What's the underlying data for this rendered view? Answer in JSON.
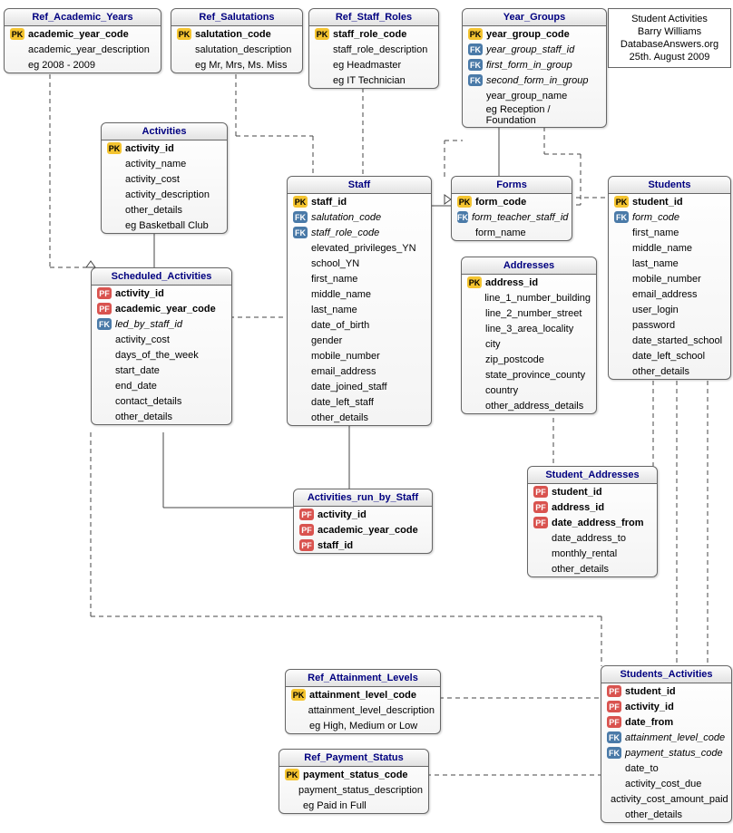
{
  "info_box": {
    "l1": "Student Activities",
    "l2": "Barry Williams",
    "l3": "DatabaseAnswers.org",
    "l4": "25th. August 2009"
  },
  "key_labels": {
    "pk": "PK",
    "fk": "FK",
    "pf": "PF"
  },
  "entities": {
    "ref_academic_years": {
      "title": "Ref_Academic_Years",
      "attrs": [
        {
          "k": "pk",
          "t": "academic_year_code",
          "b": true
        },
        {
          "t": "academic_year_description"
        },
        {
          "t": "eg 2008 - 2009"
        }
      ]
    },
    "ref_salutations": {
      "title": "Ref_Salutations",
      "attrs": [
        {
          "k": "pk",
          "t": "salutation_code",
          "b": true
        },
        {
          "t": "salutation_description"
        },
        {
          "t": "eg Mr, Mrs, Ms. Miss"
        }
      ]
    },
    "ref_staff_roles": {
      "title": "Ref_Staff_Roles",
      "attrs": [
        {
          "k": "pk",
          "t": "staff_role_code",
          "b": true
        },
        {
          "t": "staff_role_description"
        },
        {
          "t": "eg Headmaster"
        },
        {
          "t": "eg IT Technician"
        }
      ]
    },
    "year_groups": {
      "title": "Year_Groups",
      "attrs": [
        {
          "k": "pk",
          "t": "year_group_code",
          "b": true
        },
        {
          "k": "fk",
          "t": "year_group_staff_id",
          "i": true
        },
        {
          "k": "fk",
          "t": "first_form_in_group",
          "i": true
        },
        {
          "k": "fk",
          "t": "second_form_in_group",
          "i": true
        },
        {
          "t": "year_group_name"
        },
        {
          "t": "eg Reception / Foundation"
        }
      ]
    },
    "activities": {
      "title": "Activities",
      "attrs": [
        {
          "k": "pk",
          "t": "activity_id",
          "b": true
        },
        {
          "t": "activity_name"
        },
        {
          "t": "activity_cost"
        },
        {
          "t": "activity_description"
        },
        {
          "t": "other_details"
        },
        {
          "t": "eg Basketball Club"
        }
      ]
    },
    "staff": {
      "title": "Staff",
      "attrs": [
        {
          "k": "pk",
          "t": "staff_id",
          "b": true
        },
        {
          "k": "fk",
          "t": "salutation_code",
          "i": true
        },
        {
          "k": "fk",
          "t": "staff_role_code",
          "i": true
        },
        {
          "t": "elevated_privileges_YN"
        },
        {
          "t": "school_YN"
        },
        {
          "t": "first_name"
        },
        {
          "t": "middle_name"
        },
        {
          "t": "last_name"
        },
        {
          "t": "date_of_birth"
        },
        {
          "t": "gender"
        },
        {
          "t": "mobile_number"
        },
        {
          "t": "email_address"
        },
        {
          "t": "date_joined_staff"
        },
        {
          "t": "date_left_staff"
        },
        {
          "t": "other_details"
        }
      ]
    },
    "forms": {
      "title": "Forms",
      "attrs": [
        {
          "k": "pk",
          "t": "form_code",
          "b": true
        },
        {
          "k": "fk",
          "t": "form_teacher_staff_id",
          "i": true
        },
        {
          "t": "form_name"
        }
      ]
    },
    "students": {
      "title": "Students",
      "attrs": [
        {
          "k": "pk",
          "t": "student_id",
          "b": true
        },
        {
          "k": "fk",
          "t": "form_code",
          "i": true
        },
        {
          "t": "first_name"
        },
        {
          "t": "middle_name"
        },
        {
          "t": "last_name"
        },
        {
          "t": "mobile_number"
        },
        {
          "t": "email_address"
        },
        {
          "t": "user_login"
        },
        {
          "t": "password"
        },
        {
          "t": "date_started_school"
        },
        {
          "t": "date_left_school"
        },
        {
          "t": "other_details"
        }
      ]
    },
    "scheduled_activities": {
      "title": "Scheduled_Activities",
      "attrs": [
        {
          "k": "pf",
          "t": "activity_id",
          "b": true
        },
        {
          "k": "pf",
          "t": "academic_year_code",
          "b": true
        },
        {
          "k": "fk",
          "t": "led_by_staff_id",
          "i": true
        },
        {
          "t": "activity_cost"
        },
        {
          "t": "days_of_the_week"
        },
        {
          "t": "start_date"
        },
        {
          "t": "end_date"
        },
        {
          "t": "contact_details"
        },
        {
          "t": "other_details"
        }
      ]
    },
    "addresses": {
      "title": "Addresses",
      "attrs": [
        {
          "k": "pk",
          "t": "address_id",
          "b": true
        },
        {
          "t": "line_1_number_building"
        },
        {
          "t": "line_2_number_street"
        },
        {
          "t": "line_3_area_locality"
        },
        {
          "t": "city"
        },
        {
          "t": "zip_postcode"
        },
        {
          "t": "state_province_county"
        },
        {
          "t": "country"
        },
        {
          "t": "other_address_details"
        }
      ]
    },
    "activities_run_by_staff": {
      "title": "Activities_run_by_Staff",
      "attrs": [
        {
          "k": "pf",
          "t": "activity_id",
          "b": true
        },
        {
          "k": "pf",
          "t": "academic_year_code",
          "b": true
        },
        {
          "k": "pf",
          "t": "staff_id",
          "b": true
        }
      ]
    },
    "student_addresses": {
      "title": "Student_Addresses",
      "attrs": [
        {
          "k": "pf",
          "t": "student_id",
          "b": true
        },
        {
          "k": "pf",
          "t": "address_id",
          "b": true
        },
        {
          "k": "pf",
          "t": "date_address_from",
          "b": true
        },
        {
          "t": "date_address_to"
        },
        {
          "t": "monthly_rental"
        },
        {
          "t": "other_details"
        }
      ]
    },
    "ref_attainment_levels": {
      "title": "Ref_Attainment_Levels",
      "attrs": [
        {
          "k": "pk",
          "t": "attainment_level_code",
          "b": true
        },
        {
          "t": "attainment_level_description"
        },
        {
          "t": "eg High, Medium or Low"
        }
      ]
    },
    "ref_payment_status": {
      "title": "Ref_Payment_Status",
      "attrs": [
        {
          "k": "pk",
          "t": "payment_status_code",
          "b": true
        },
        {
          "t": "payment_status_description"
        },
        {
          "t": "eg Paid in Full"
        }
      ]
    },
    "students_activities": {
      "title": "Students_Activities",
      "attrs": [
        {
          "k": "pf",
          "t": "student_id",
          "b": true
        },
        {
          "k": "pf",
          "t": "activity_id",
          "b": true
        },
        {
          "k": "pf",
          "t": "date_from",
          "b": true
        },
        {
          "k": "fk",
          "t": "attainment_level_code",
          "i": true
        },
        {
          "k": "fk",
          "t": "payment_status_code",
          "i": true
        },
        {
          "t": "date_to"
        },
        {
          "t": "activity_cost_due"
        },
        {
          "t": "activity_cost_amount_paid"
        },
        {
          "t": "other_details"
        }
      ]
    }
  }
}
